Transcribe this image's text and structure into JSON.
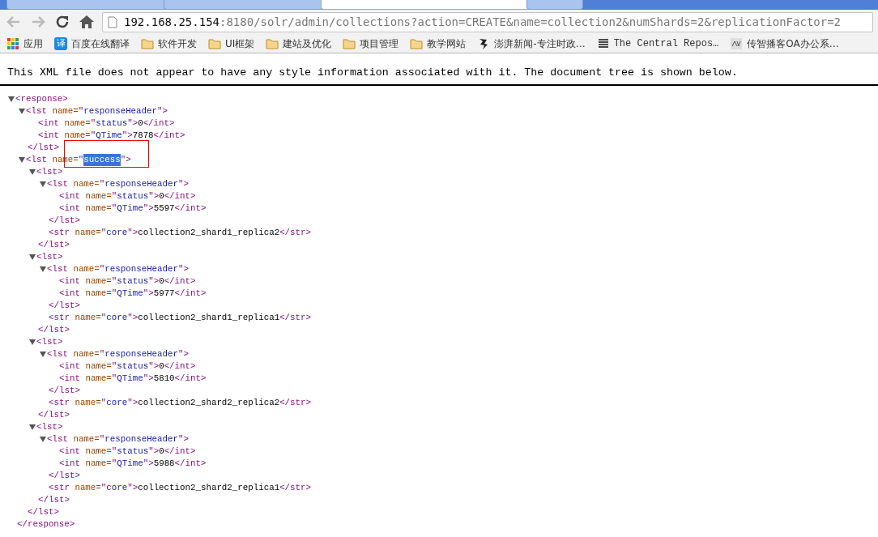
{
  "tabs": [
    {
      "selected": false
    },
    {
      "selected": false
    },
    {
      "selected": true
    }
  ],
  "address_bar": {
    "host": "192.168.25.154",
    "rest": ":8180/solr/admin/collections?action=CREATE&name=collection2&numShards=2&replicationFactor=2"
  },
  "bookmarks": [
    {
      "kind": "apps",
      "label": "应用"
    },
    {
      "kind": "site",
      "label": "百度在线翻译",
      "icon_text": "译"
    },
    {
      "kind": "folder",
      "label": "软件开发"
    },
    {
      "kind": "folder",
      "label": "UI框架"
    },
    {
      "kind": "folder",
      "label": "建站及优化"
    },
    {
      "kind": "folder",
      "label": "项目管理"
    },
    {
      "kind": "folder",
      "label": "教学网站"
    },
    {
      "kind": "site",
      "label": "澎湃新闻-专注时政…"
    },
    {
      "kind": "site",
      "label": "The Central Repos…"
    },
    {
      "kind": "site",
      "label": "传智播客OA办公系…"
    }
  ],
  "info_message": "This XML file does not appear to have any style information associated with it. The document tree is shown below.",
  "xml_tree": [
    {
      "tag_open": "<response>",
      "expanded": true,
      "close": "</response>",
      "children": [
        {
          "tag_open": "<lst",
          "attr": "name=",
          "q": "\"",
          "value": "responseHeader",
          "tag_end": "\">",
          "expanded": true,
          "close": "</lst>",
          "children": [
            {
              "tag_open": "<int",
              "attr": "name=",
              "q": "\"",
              "value": "status",
              "tag_end": "\">",
              "text": "0",
              "close": "</int>"
            },
            {
              "tag_open": "<int",
              "attr": "name=",
              "q": "\"",
              "value": "QTime",
              "tag_end": "\">",
              "text": "7878",
              "close": "</int>"
            }
          ]
        },
        {
          "tag_open": "<lst",
          "attr": "name=",
          "q": "\"",
          "value": "success",
          "tag_end": "\">",
          "highlighted": true,
          "boxed": true,
          "expanded": true,
          "close": "</lst>",
          "children": [
            {
              "tag_open": "<lst>",
              "expanded": true,
              "close": "</lst>",
              "children": [
                {
                  "tag_open": "<lst",
                  "attr": "name=",
                  "q": "\"",
                  "value": "responseHeader",
                  "tag_end": "\">",
                  "expanded": true,
                  "close": "</lst>",
                  "children": [
                    {
                      "tag_open": "<int",
                      "attr": "name=",
                      "q": "\"",
                      "value": "status",
                      "tag_end": "\">",
                      "text": "0",
                      "close": "</int>"
                    },
                    {
                      "tag_open": "<int",
                      "attr": "name=",
                      "q": "\"",
                      "value": "QTime",
                      "tag_end": "\">",
                      "text": "5597",
                      "close": "</int>"
                    }
                  ]
                },
                {
                  "tag_open": "<str",
                  "attr": "name=",
                  "q": "\"",
                  "value": "core",
                  "tag_end": "\">",
                  "text": "collection2_shard1_replica2",
                  "close": "</str>"
                }
              ]
            },
            {
              "tag_open": "<lst>",
              "expanded": true,
              "close": "</lst>",
              "children": [
                {
                  "tag_open": "<lst",
                  "attr": "name=",
                  "q": "\"",
                  "value": "responseHeader",
                  "tag_end": "\">",
                  "expanded": true,
                  "close": "</lst>",
                  "children": [
                    {
                      "tag_open": "<int",
                      "attr": "name=",
                      "q": "\"",
                      "value": "status",
                      "tag_end": "\">",
                      "text": "0",
                      "close": "</int>"
                    },
                    {
                      "tag_open": "<int",
                      "attr": "name=",
                      "q": "\"",
                      "value": "QTime",
                      "tag_end": "\">",
                      "text": "5977",
                      "close": "</int>"
                    }
                  ]
                },
                {
                  "tag_open": "<str",
                  "attr": "name=",
                  "q": "\"",
                  "value": "core",
                  "tag_end": "\">",
                  "text": "collection2_shard1_replica1",
                  "close": "</str>"
                }
              ]
            },
            {
              "tag_open": "<lst>",
              "expanded": true,
              "close": "</lst>",
              "children": [
                {
                  "tag_open": "<lst",
                  "attr": "name=",
                  "q": "\"",
                  "value": "responseHeader",
                  "tag_end": "\">",
                  "expanded": true,
                  "close": "</lst>",
                  "children": [
                    {
                      "tag_open": "<int",
                      "attr": "name=",
                      "q": "\"",
                      "value": "status",
                      "tag_end": "\">",
                      "text": "0",
                      "close": "</int>"
                    },
                    {
                      "tag_open": "<int",
                      "attr": "name=",
                      "q": "\"",
                      "value": "QTime",
                      "tag_end": "\">",
                      "text": "5810",
                      "close": "</int>"
                    }
                  ]
                },
                {
                  "tag_open": "<str",
                  "attr": "name=",
                  "q": "\"",
                  "value": "core",
                  "tag_end": "\">",
                  "text": "collection2_shard2_replica2",
                  "close": "</str>"
                }
              ]
            },
            {
              "tag_open": "<lst>",
              "expanded": true,
              "close": "</lst>",
              "children": [
                {
                  "tag_open": "<lst",
                  "attr": "name=",
                  "q": "\"",
                  "value": "responseHeader",
                  "tag_end": "\">",
                  "expanded": true,
                  "close": "</lst>",
                  "children": [
                    {
                      "tag_open": "<int",
                      "attr": "name=",
                      "q": "\"",
                      "value": "status",
                      "tag_end": "\">",
                      "text": "0",
                      "close": "</int>"
                    },
                    {
                      "tag_open": "<int",
                      "attr": "name=",
                      "q": "\"",
                      "value": "QTime",
                      "tag_end": "\">",
                      "text": "5988",
                      "close": "</int>"
                    }
                  ]
                },
                {
                  "tag_open": "<str",
                  "attr": "name=",
                  "q": "\"",
                  "value": "core",
                  "tag_end": "\">",
                  "text": "collection2_shard2_replica1",
                  "close": "</str>"
                }
              ]
            }
          ]
        }
      ]
    }
  ]
}
